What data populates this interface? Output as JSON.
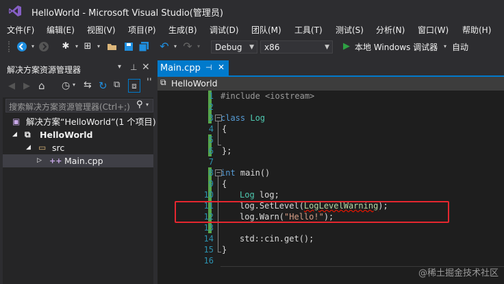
{
  "window": {
    "title": "HelloWorld - Microsoft Visual Studio(管理员)"
  },
  "menu": [
    "文件(F)",
    "编辑(E)",
    "视图(V)",
    "项目(P)",
    "生成(B)",
    "调试(D)",
    "团队(M)",
    "工具(T)",
    "测试(S)",
    "分析(N)",
    "窗口(W)",
    "帮助(H)"
  ],
  "toolbar": {
    "config": "Debug",
    "platform": "x86",
    "debugger": "本地 Windows 调试器",
    "auto": "自动"
  },
  "solution_explorer": {
    "title": "解决方案资源管理器",
    "search_placeholder": "搜索解决方案资源管理器(Ctrl+;)",
    "items": [
      {
        "label": "解决方案“HelloWorld”(1 个项目)"
      },
      {
        "label": "HelloWorld"
      },
      {
        "label": "src"
      },
      {
        "label": "Main.cpp"
      }
    ]
  },
  "editor": {
    "tab": "Main.cpp",
    "nav": "HelloWorld",
    "line_numbers": [
      "1",
      "2",
      "3",
      "4",
      "5",
      "6",
      "7",
      "8",
      "9",
      "10",
      "11",
      "12",
      "13",
      "14",
      "15",
      "16"
    ],
    "code": {
      "l1": "#include <iostream>",
      "l3_kw": "class",
      "l3_name": "Log",
      "l4": "{",
      "l6": "};",
      "l8_kw": "int",
      "l8_rest": "main()",
      "l9": "{",
      "l10_type": "Log",
      "l10_rest": "log;",
      "l11_a": "log.SetLevel(",
      "l11_b": "LogLevelWarning",
      "l11_c": ");",
      "l12_a": "log.Warn(",
      "l12_b": "\"Hello!\"",
      "l12_c": ");",
      "l14": "std::cin.get();",
      "l15": "}"
    }
  },
  "watermark": "@稀土掘金技术社区",
  "colors": {
    "accent": "#007acc",
    "highlight_box": "#e6272f"
  }
}
